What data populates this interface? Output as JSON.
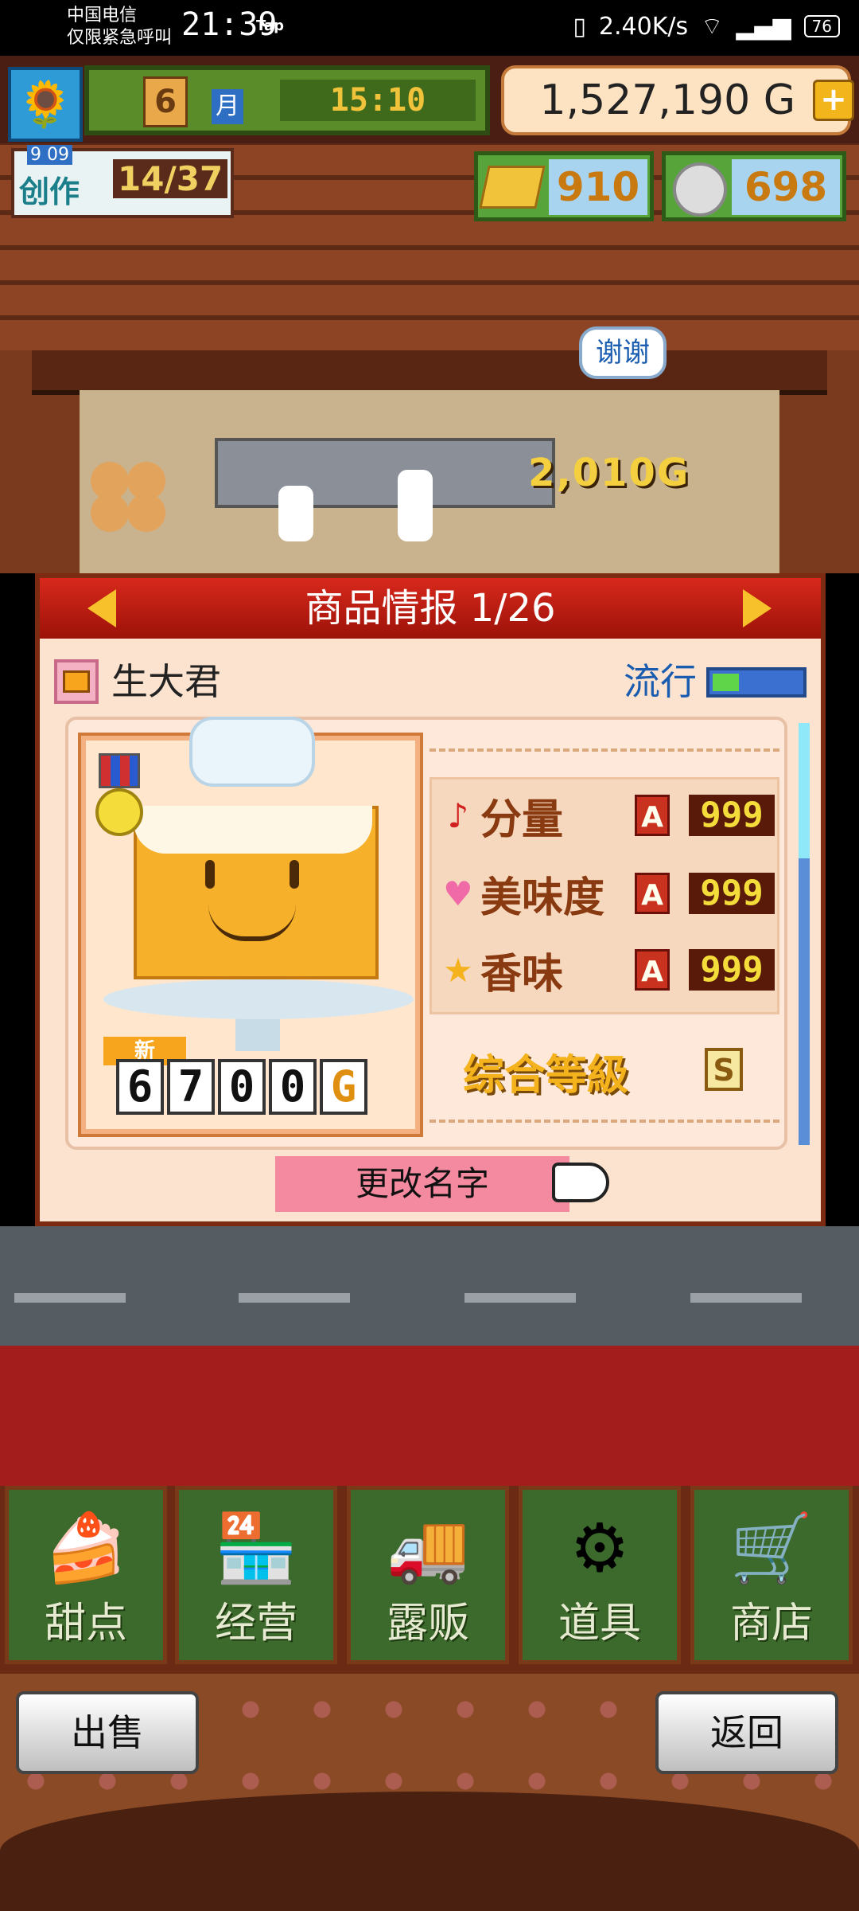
{
  "status_bar": {
    "carrier_line1": "中国电信",
    "carrier_line2": "仅限紧急呼叫",
    "time": "21:39",
    "tap": "Tap",
    "network_speed": "2.40K/s",
    "battery": "76"
  },
  "hud": {
    "month": "6",
    "month_char": "月",
    "clock": "15:10",
    "money": "1,527,190",
    "money_unit": "G",
    "plus": "+"
  },
  "craft": {
    "date": "9 09",
    "label": "创作",
    "count": "14/37"
  },
  "resources": {
    "gold": "910",
    "silver": "698"
  },
  "scene": {
    "thanks": "谢谢",
    "score_popup": "2,010G"
  },
  "panel": {
    "title": "商品情报 1/26",
    "product_name": "生大君",
    "trend_label": "流行",
    "trend_level": 0.3,
    "new_badge": "新",
    "price_digits": [
      "6",
      "7",
      "0",
      "0"
    ],
    "price_unit": "G",
    "stats": [
      {
        "icon": "♪",
        "label": "分量",
        "grade": "A",
        "value": "999"
      },
      {
        "icon": "♥",
        "label": "美味度",
        "grade": "A",
        "value": "999"
      },
      {
        "icon": "★",
        "label": "香味",
        "grade": "A",
        "value": "999"
      }
    ],
    "overall_label": "综合等級",
    "overall_grade": "S",
    "rename_button": "更改名字"
  },
  "menu": [
    {
      "label": "甜点",
      "icon": "🍰"
    },
    {
      "label": "经营",
      "icon": "🏪"
    },
    {
      "label": "露贩",
      "icon": "🚚"
    },
    {
      "label": "道具",
      "icon": "⚙"
    },
    {
      "label": "商店",
      "icon": "🛒"
    }
  ],
  "footer": {
    "sell": "出售",
    "back": "返回"
  }
}
